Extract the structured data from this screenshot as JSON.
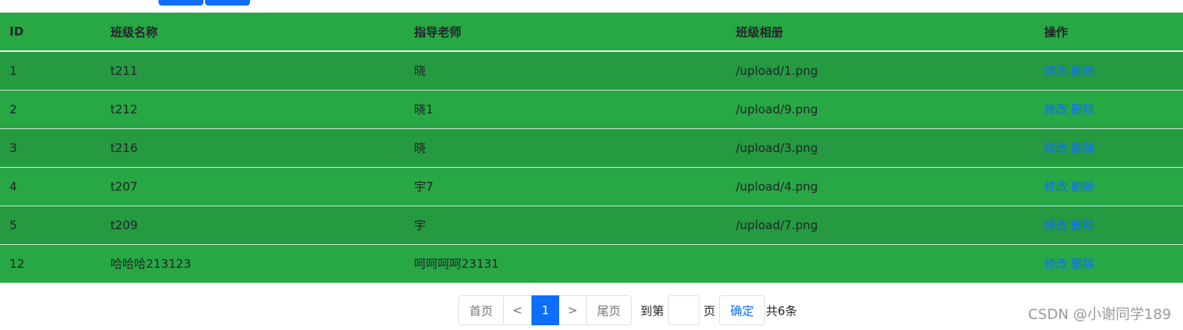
{
  "table": {
    "headers": [
      "ID",
      "班级名称",
      "指导老师",
      "班级相册",
      "操作"
    ],
    "rows": [
      {
        "id": "1",
        "name": "t211",
        "teacher": "晓",
        "album": "/upload/1.png"
      },
      {
        "id": "2",
        "name": "t212",
        "teacher": "晓1",
        "album": "/upload/9.png"
      },
      {
        "id": "3",
        "name": "t216",
        "teacher": "晓",
        "album": "/upload/3.png"
      },
      {
        "id": "4",
        "name": "t207",
        "teacher": "宇7",
        "album": "/upload/4.png"
      },
      {
        "id": "5",
        "name": "t209",
        "teacher": "宇",
        "album": "/upload/7.png"
      },
      {
        "id": "12",
        "name": "哈哈哈213123",
        "teacher": "呵呵呵呵23131",
        "album": ""
      }
    ],
    "edit_label": "修改",
    "delete_label": "删除"
  },
  "pager": {
    "first": "首页",
    "prev": "<",
    "current": "1",
    "next": ">",
    "last": "尾页",
    "goto_prefix": "到第",
    "goto_input": "",
    "goto_suffix": "页",
    "confirm": "确定",
    "total": "共6条"
  },
  "watermark": "CSDN @小谢同学189",
  "colors": {
    "table_bg": "#28a745",
    "row_alt_bg": "#259a41",
    "link": "#0d6efd",
    "primary": "#0d6efd"
  }
}
